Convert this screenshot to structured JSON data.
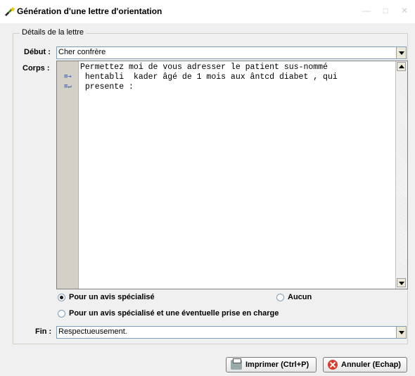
{
  "window": {
    "title": "Génération d'une lettre d'orientation",
    "icon": "wand-icon"
  },
  "group": {
    "legend": "Détails de la lettre"
  },
  "debut": {
    "label": "Début :",
    "value": "Cher confrère"
  },
  "corps": {
    "label": "Corps :",
    "lines": [
      "Permettez moi de vous adresser le patient sus-nommé",
      " hentabli  kader âgé de 1 mois aux ântcd diabet , qui",
      " presente :"
    ]
  },
  "options": {
    "avis_specialise": "Pour un avis spécialisé",
    "aucun": "Aucun",
    "avis_prise_en_charge": "Pour un avis spécialisé et une éventuelle prise en charge",
    "selected": "avis_specialise"
  },
  "fin": {
    "label": "Fin :",
    "value": "Respectueusement."
  },
  "buttons": {
    "print": "Imprimer (Ctrl+P)",
    "cancel": "Annuler (Echap)"
  },
  "colors": {
    "background": "#f0f0f0",
    "cancel_icon": "#d83a2b"
  }
}
